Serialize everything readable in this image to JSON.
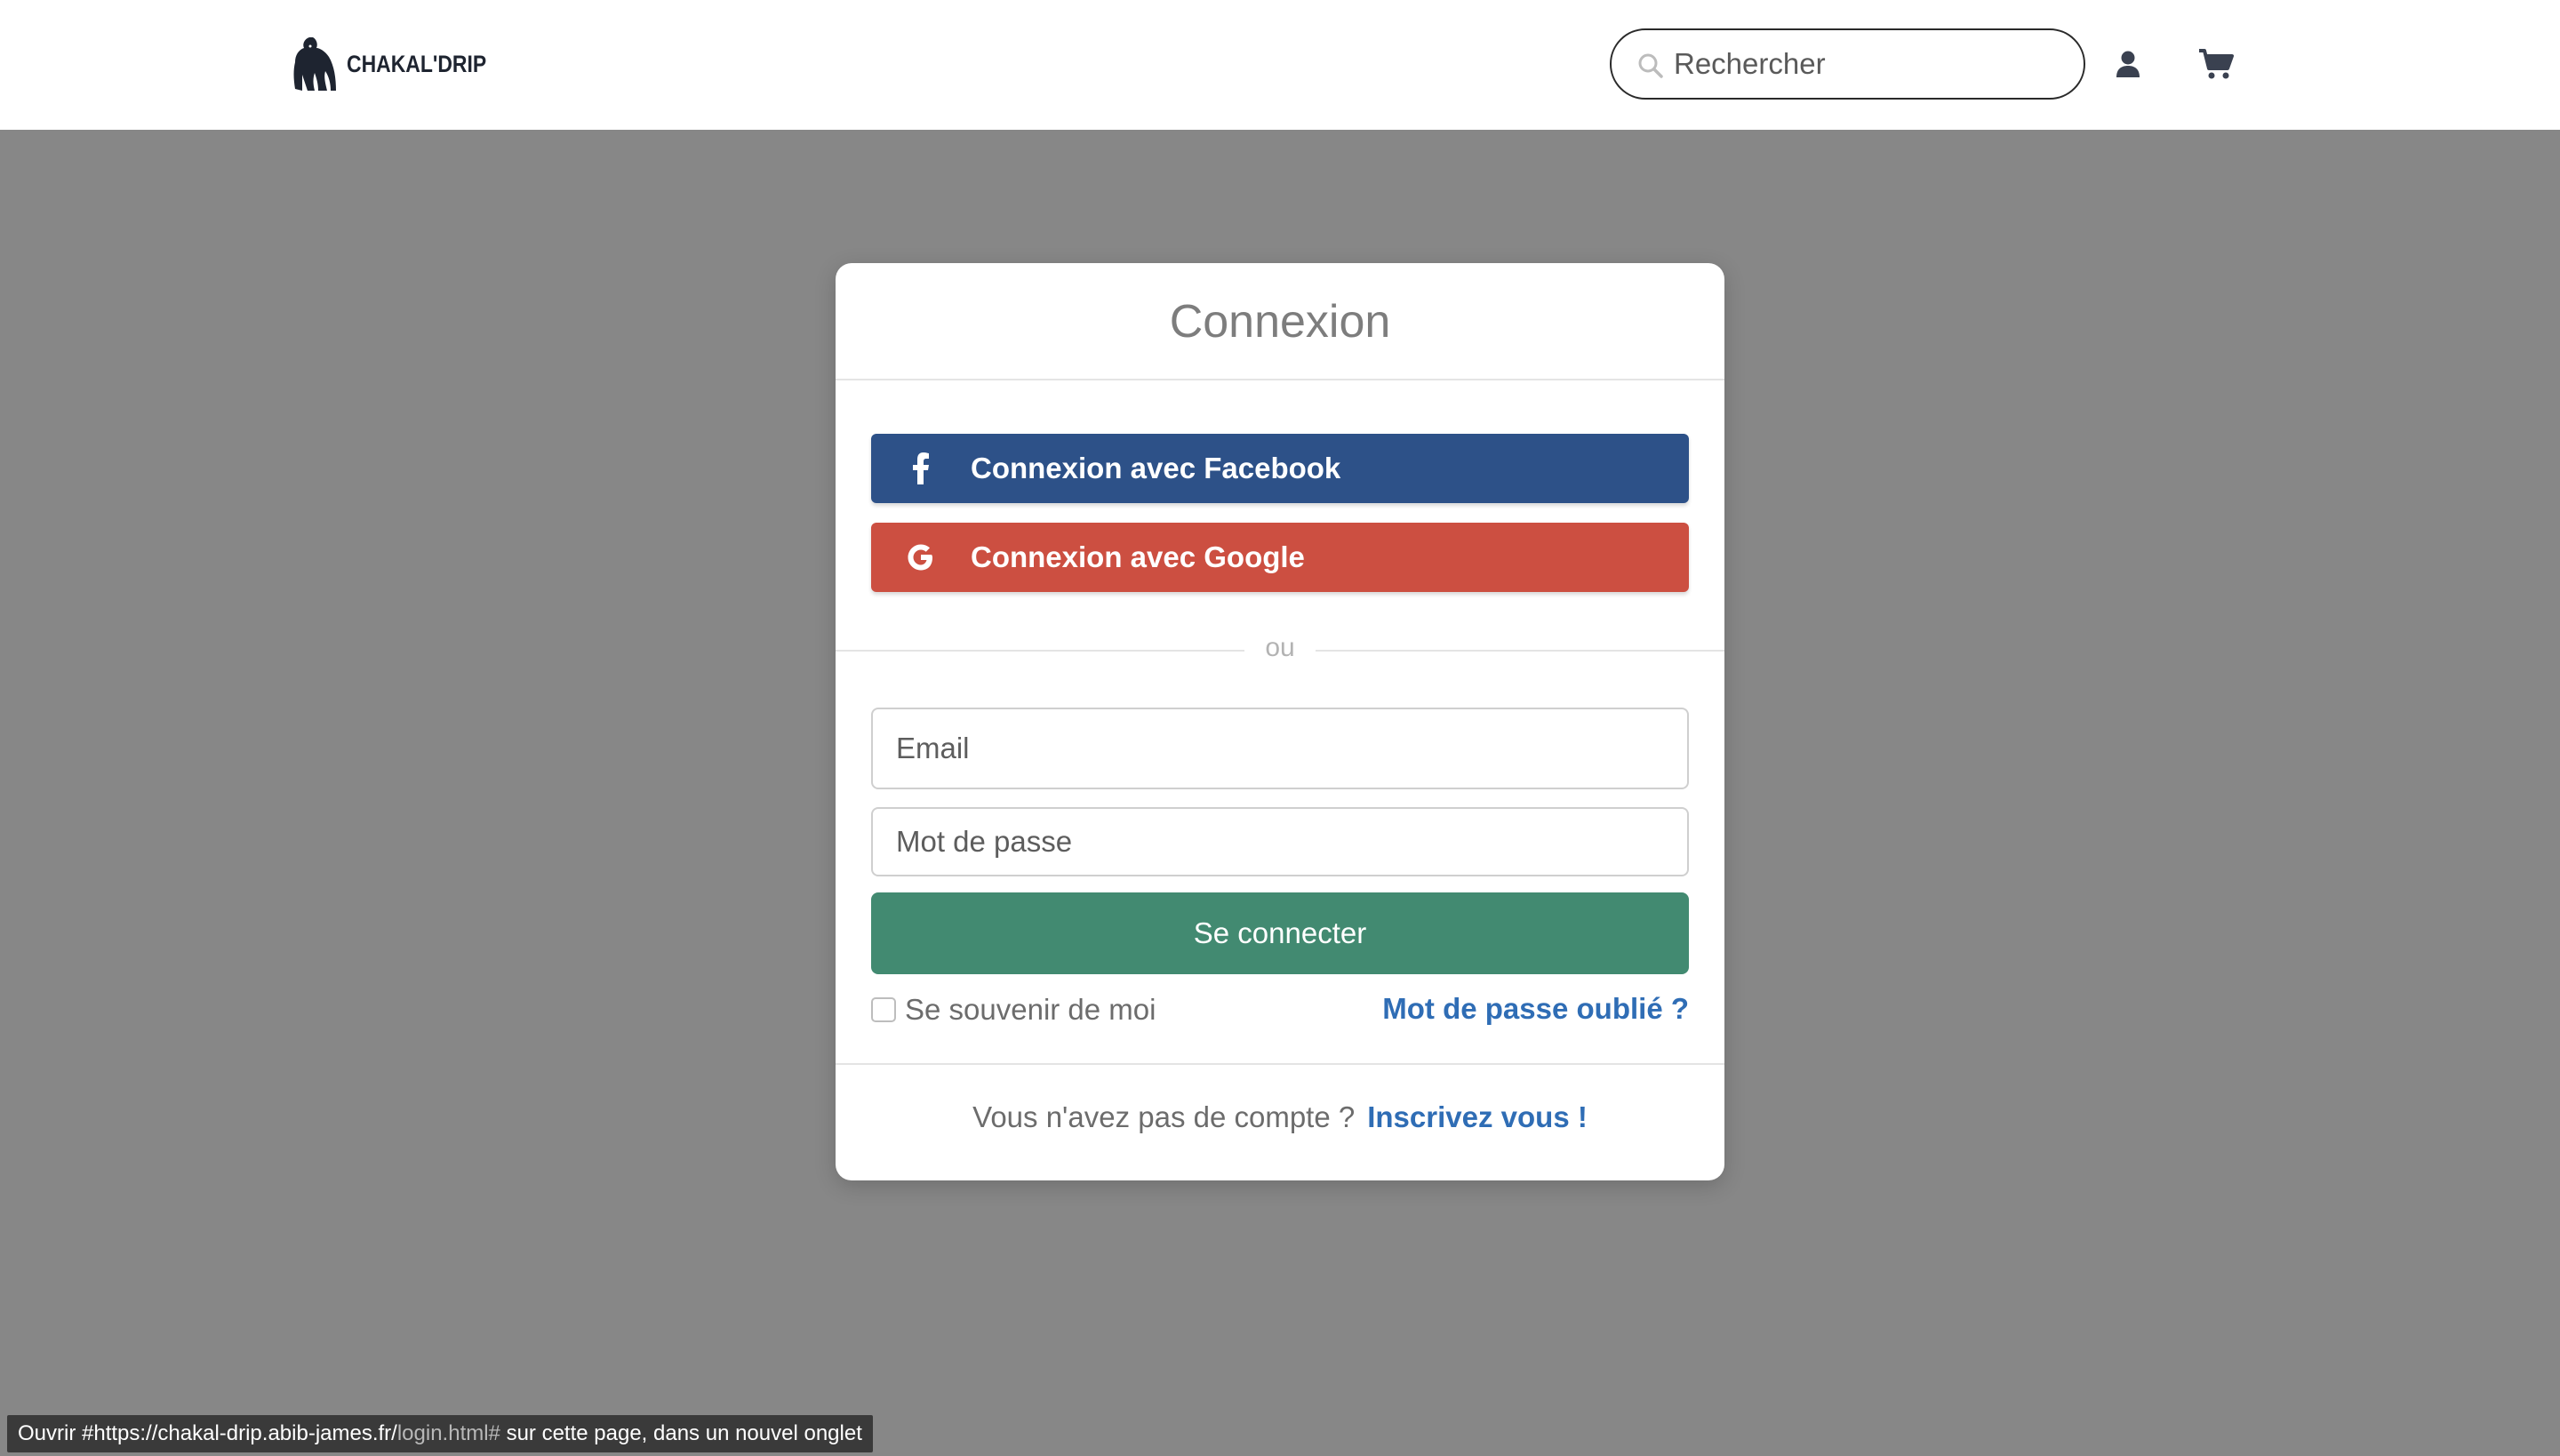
{
  "header": {
    "logo_text": "CHAKAL'DRIP",
    "search_placeholder": "Rechercher"
  },
  "login": {
    "title": "Connexion",
    "facebook_label": "Connexion avec Facebook",
    "google_label": "Connexion avec Google",
    "or_text": "ou",
    "email_placeholder": "Email",
    "password_placeholder": "Mot de passe",
    "submit_label": "Se connecter",
    "remember_label": "Se souvenir de moi",
    "forgot_label": "Mot de passe oublié ?",
    "signup_prompt": "Vous n'avez pas de compte ?",
    "signup_link": "Inscrivez vous !"
  },
  "status_bar": {
    "prefix": "Ouvrir #",
    "url_host": "https://chakal-drip.abib-james.fr/",
    "url_path": "login.html#",
    "suffix": " sur cette page, dans un nouvel onglet"
  },
  "colors": {
    "facebook": "#2d5188",
    "google": "#cc4f41",
    "primary": "#428a71",
    "link": "#2f6db5",
    "overlay": "#878787"
  },
  "icons": [
    "logo-gorilla-icon",
    "search-icon",
    "user-icon",
    "cart-icon",
    "facebook-icon",
    "google-icon"
  ]
}
